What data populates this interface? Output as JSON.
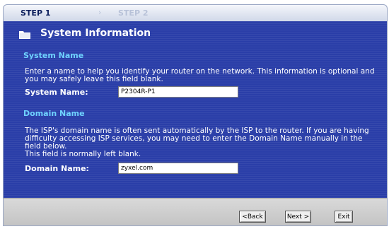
{
  "steps": {
    "step1": "STEP 1",
    "separator": "›",
    "step2": "STEP 2"
  },
  "title": "System Information",
  "system_name": {
    "heading": "System Name",
    "description": "Enter a name to help you identify your router on the network. This information is optional and you may safely leave this field blank.",
    "label": "System Name:",
    "value": "P2304R-P1"
  },
  "domain_name": {
    "heading": "Domain Name",
    "description": "The ISP's domain name is often sent automatically by the ISP to the router. If you are having difficulty accessing ISP services, you may need to enter the Domain Name manually in the field below.",
    "note": "This field is normally left blank.",
    "label": "Domain Name:",
    "value": "zyxel.com"
  },
  "buttons": {
    "back": "<Back",
    "next": "Next >",
    "exit": "Exit"
  }
}
